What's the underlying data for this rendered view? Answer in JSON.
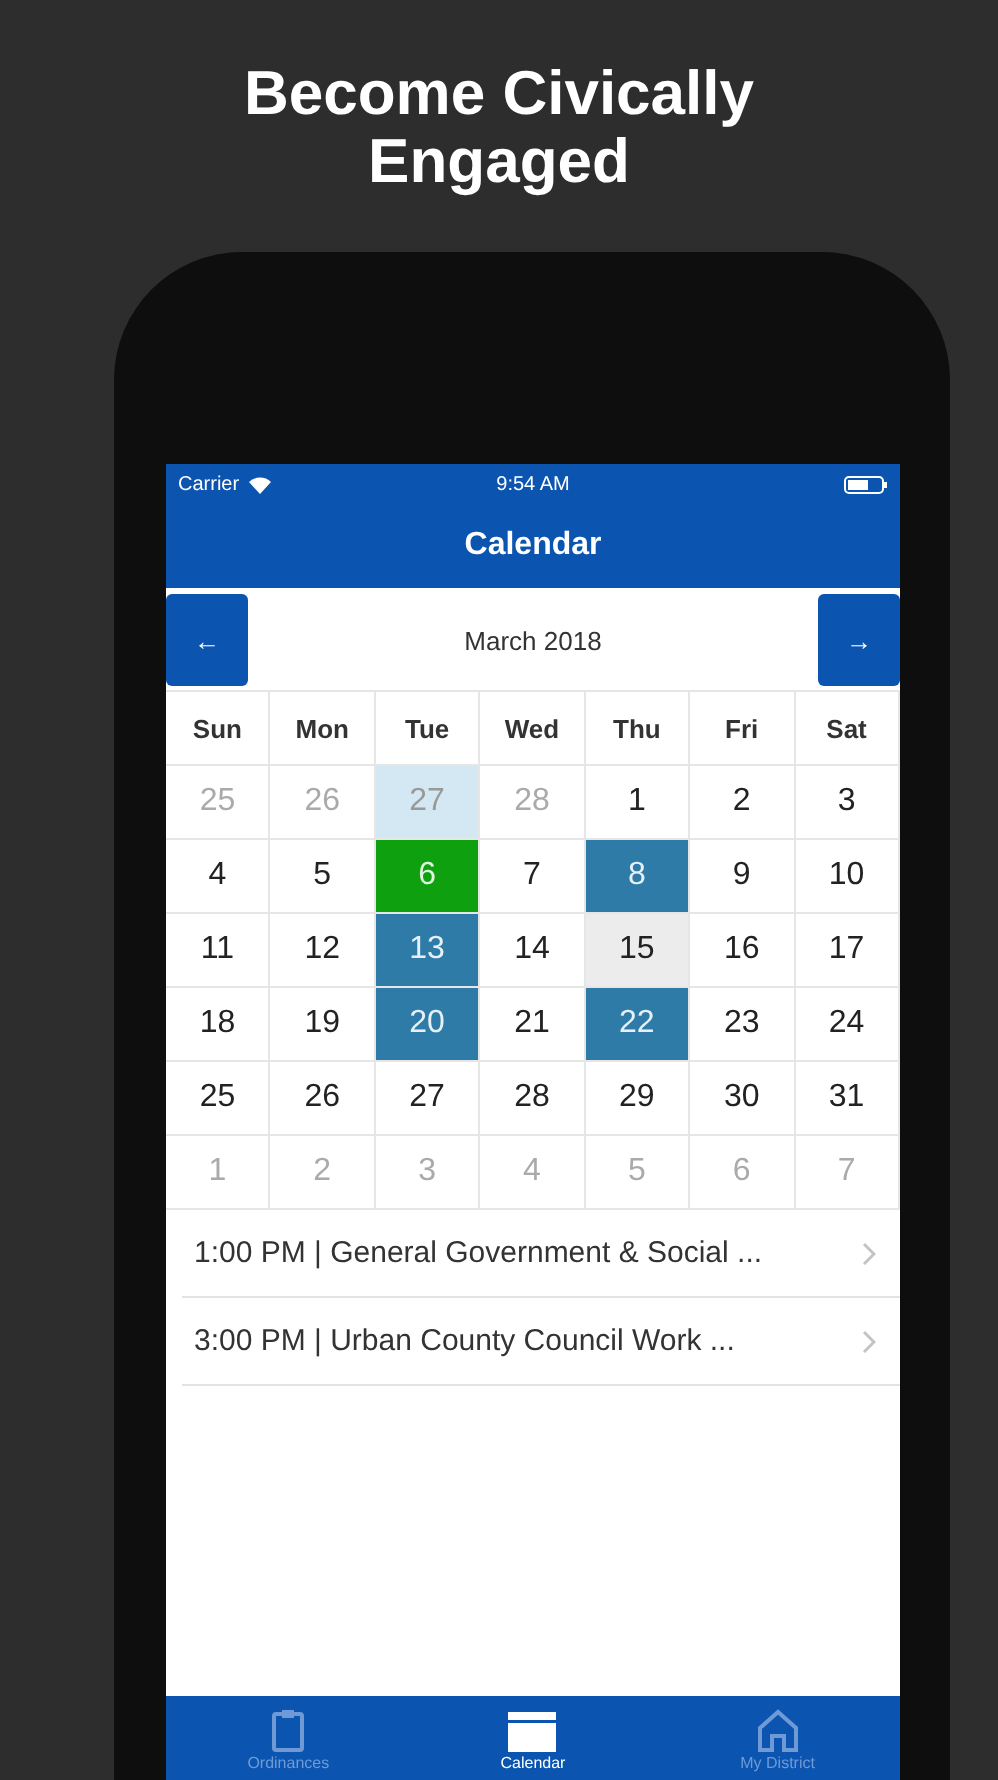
{
  "headline": "Become Civically Engaged",
  "status_bar": {
    "carrier": "Carrier",
    "time": "9:54 AM"
  },
  "nav": {
    "title": "Calendar"
  },
  "month": {
    "prev": "←",
    "label": "March 2018",
    "next": "→"
  },
  "weekdays": [
    "Sun",
    "Mon",
    "Tue",
    "Wed",
    "Thu",
    "Fri",
    "Sat"
  ],
  "weeks": [
    [
      {
        "day": "25",
        "kind": "outside",
        "selected": false
      },
      {
        "day": "26",
        "kind": "outside",
        "selected": false
      },
      {
        "day": "27",
        "kind": "outside-event",
        "selected": false
      },
      {
        "day": "28",
        "kind": "outside",
        "selected": false
      },
      {
        "day": "1",
        "kind": "day",
        "selected": false
      },
      {
        "day": "2",
        "kind": "day",
        "selected": false
      },
      {
        "day": "3",
        "kind": "day",
        "selected": false
      }
    ],
    [
      {
        "day": "4",
        "kind": "day",
        "selected": false
      },
      {
        "day": "5",
        "kind": "day",
        "selected": false
      },
      {
        "day": "6",
        "kind": "event",
        "selected": true
      },
      {
        "day": "7",
        "kind": "day",
        "selected": false
      },
      {
        "day": "8",
        "kind": "event",
        "selected": false
      },
      {
        "day": "9",
        "kind": "day",
        "selected": false
      },
      {
        "day": "10",
        "kind": "day",
        "selected": false
      }
    ],
    [
      {
        "day": "11",
        "kind": "day",
        "selected": false
      },
      {
        "day": "12",
        "kind": "day",
        "selected": false
      },
      {
        "day": "13",
        "kind": "event",
        "selected": false
      },
      {
        "day": "14",
        "kind": "day",
        "selected": false
      },
      {
        "day": "15",
        "kind": "today",
        "selected": false
      },
      {
        "day": "16",
        "kind": "day",
        "selected": false
      },
      {
        "day": "17",
        "kind": "day",
        "selected": false
      }
    ],
    [
      {
        "day": "18",
        "kind": "day",
        "selected": false
      },
      {
        "day": "19",
        "kind": "day",
        "selected": false
      },
      {
        "day": "20",
        "kind": "event",
        "selected": false
      },
      {
        "day": "21",
        "kind": "day",
        "selected": false
      },
      {
        "day": "22",
        "kind": "event",
        "selected": false
      },
      {
        "day": "23",
        "kind": "day",
        "selected": false
      },
      {
        "day": "24",
        "kind": "day",
        "selected": false
      }
    ],
    [
      {
        "day": "25",
        "kind": "day",
        "selected": false
      },
      {
        "day": "26",
        "kind": "day",
        "selected": false
      },
      {
        "day": "27",
        "kind": "day",
        "selected": false
      },
      {
        "day": "28",
        "kind": "day",
        "selected": false
      },
      {
        "day": "29",
        "kind": "day",
        "selected": false
      },
      {
        "day": "30",
        "kind": "day",
        "selected": false
      },
      {
        "day": "31",
        "kind": "day",
        "selected": false
      }
    ],
    [
      {
        "day": "1",
        "kind": "outside",
        "selected": false
      },
      {
        "day": "2",
        "kind": "outside",
        "selected": false
      },
      {
        "day": "3",
        "kind": "outside",
        "selected": false
      },
      {
        "day": "4",
        "kind": "outside",
        "selected": false
      },
      {
        "day": "5",
        "kind": "outside",
        "selected": false
      },
      {
        "day": "6",
        "kind": "outside",
        "selected": false
      },
      {
        "day": "7",
        "kind": "outside",
        "selected": false
      }
    ]
  ],
  "events": [
    {
      "text": "1:00 PM | General Government & Social ..."
    },
    {
      "text": "3:00 PM | Urban County Council Work ..."
    }
  ],
  "tab_bar": [
    {
      "label": "Ordinances",
      "kind": "clipboard",
      "selected": false
    },
    {
      "label": "Calendar",
      "kind": "calendar",
      "selected": true
    },
    {
      "label": "My District",
      "kind": "home",
      "selected": false
    }
  ]
}
